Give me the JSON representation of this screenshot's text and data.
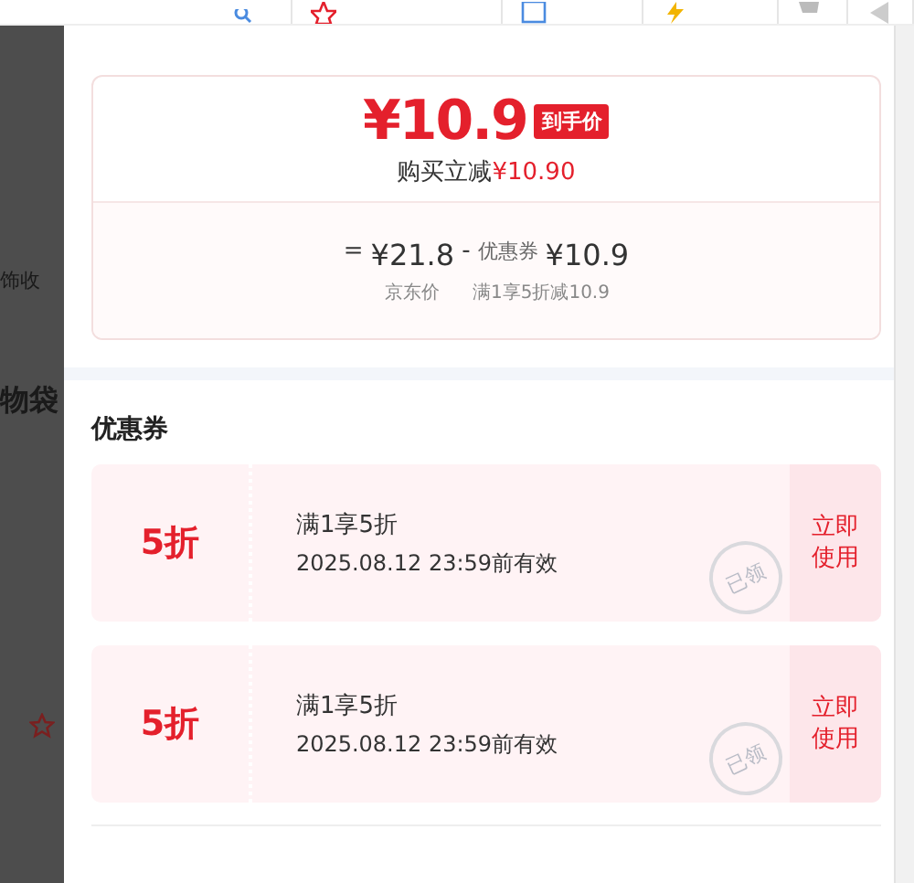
{
  "background_page": {
    "texts": [
      "饰收",
      "物袋"
    ]
  },
  "price_card": {
    "final_price": "¥10.9",
    "final_tag": "到手价",
    "discount_label": "购买立减",
    "discount_amount": "¥10.90",
    "equals": "=",
    "base_price": "¥21.8",
    "minus": "-",
    "coupon_label": "优惠券",
    "coupon_amount": "¥10.9",
    "base_caption": "京东价",
    "coupon_caption": "满1享5折减10.9"
  },
  "coupons_section": {
    "title": "优惠券",
    "coupons": [
      {
        "value": "5折",
        "condition": "满1享5折",
        "validity": "2025.08.12 23:59前有效",
        "stamp": "已领",
        "action": "立即使用"
      },
      {
        "value": "5折",
        "condition": "满1享5折",
        "validity": "2025.08.12 23:59前有效",
        "stamp": "已领",
        "action": "立即使用"
      }
    ]
  }
}
